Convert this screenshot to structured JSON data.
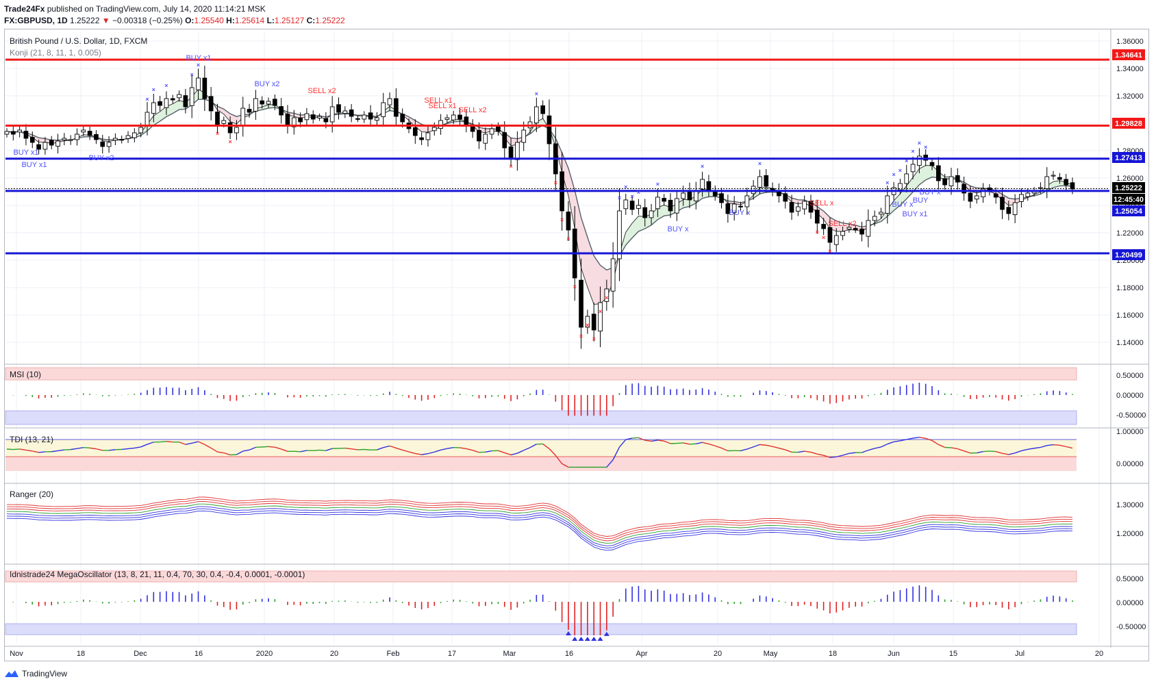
{
  "header": {
    "publisher": "Trade24Fx",
    "published_text": "published on TradingView.com, July 14, 2020 11:14:21 MSK",
    "symbol": "FX:GBPUSD, 1D",
    "last": "1.25222",
    "change": "−0.00318 (−0.25%)",
    "o_label": "O:",
    "o": "1.25540",
    "h_label": "H:",
    "h": "1.25614",
    "l_label": "L:",
    "l": "1.25127",
    "c_label": "C:",
    "c": "1.25222"
  },
  "colors": {
    "up": "#ffffff",
    "down": "#000000",
    "red_line": "#f21818",
    "blue_line": "#1515d6",
    "buy": "#5050ff",
    "sell": "#ff3030",
    "grid": "#eceff4"
  },
  "chart_data": [
    {
      "type": "candlestick",
      "title": "British Pound / U.S. Dollar, 1D, FXCM",
      "indicator": "Konji (21, 8, 11, 1, 0.005)",
      "ylim": [
        1.13,
        1.365
      ],
      "y_ticks": [
        "1.36000",
        "1.34000",
        "1.32000",
        "1.30000",
        "1.28000",
        "1.26000",
        "1.24000",
        "1.22000",
        "1.20000",
        "1.18000",
        "1.16000",
        "1.14000"
      ],
      "x_ticks": [
        "Nov",
        "18",
        "Dec",
        "16",
        "2020",
        "20",
        "Feb",
        "17",
        "Mar",
        "16",
        "Apr",
        "20",
        "May",
        "18",
        "Jun",
        "15",
        "Jul",
        "20"
      ],
      "levels": [
        {
          "label": "1.34641",
          "value": 1.34641,
          "color": "red"
        },
        {
          "label": "1.29828",
          "value": 1.29828,
          "color": "red"
        },
        {
          "label": "1.27413",
          "value": 1.27413,
          "color": "blue"
        },
        {
          "label": "1.25054",
          "value": 1.25054,
          "color": "blue"
        },
        {
          "label": "1.20499",
          "value": 1.20499,
          "color": "blue"
        }
      ],
      "price_label": "1.25222",
      "countdown": "12:45:40",
      "closes": [
        1.294,
        1.292,
        1.295,
        1.289,
        1.286,
        1.281,
        1.286,
        1.284,
        1.287,
        1.289,
        1.288,
        1.292,
        1.295,
        1.291,
        1.288,
        1.283,
        1.286,
        1.289,
        1.288,
        1.291,
        1.293,
        1.297,
        1.308,
        1.315,
        1.313,
        1.318,
        1.317,
        1.321,
        1.312,
        1.326,
        1.333,
        1.318,
        1.309,
        1.299,
        1.302,
        1.293,
        1.297,
        1.311,
        1.308,
        1.318,
        1.314,
        1.316,
        1.313,
        1.306,
        1.299,
        1.304,
        1.301,
        1.307,
        1.303,
        1.305,
        1.301,
        1.312,
        1.308,
        1.309,
        1.305,
        1.303,
        1.306,
        1.303,
        1.304,
        1.315,
        1.318,
        1.305,
        1.301,
        1.296,
        1.291,
        1.288,
        1.293,
        1.297,
        1.302,
        1.304,
        1.306,
        1.303,
        1.299,
        1.294,
        1.287,
        1.292,
        1.296,
        1.294,
        1.282,
        1.275,
        1.286,
        1.295,
        1.301,
        1.312,
        1.307,
        1.285,
        1.263,
        1.236,
        1.222,
        1.187,
        1.151,
        1.159,
        1.149,
        1.169,
        1.179,
        1.201,
        1.236,
        1.244,
        1.237,
        1.24,
        1.231,
        1.236,
        1.246,
        1.243,
        1.236,
        1.245,
        1.249,
        1.244,
        1.251,
        1.259,
        1.251,
        1.247,
        1.242,
        1.234,
        1.241,
        1.239,
        1.247,
        1.254,
        1.261,
        1.254,
        1.251,
        1.247,
        1.243,
        1.235,
        1.239,
        1.243,
        1.235,
        1.227,
        1.223,
        1.213,
        1.218,
        1.221,
        1.224,
        1.222,
        1.219,
        1.229,
        1.232,
        1.235,
        1.247,
        1.253,
        1.256,
        1.263,
        1.27,
        1.276,
        1.273,
        1.269,
        1.258,
        1.255,
        1.261,
        1.257,
        1.249,
        1.243,
        1.247,
        1.252,
        1.25,
        1.246,
        1.237,
        1.234,
        1.242,
        1.248,
        1.249,
        1.251,
        1.253,
        1.261,
        1.262,
        1.259,
        1.255,
        1.252
      ],
      "ma_fast": "dark green/red cloud",
      "labels": [
        "BUY x1",
        "BUY x1",
        "BUY x2",
        "BUY x1",
        "BUY x2",
        "SELL x2",
        "SELL x1",
        "SELL x2",
        "SELL x1",
        "BUY x",
        "BUY x",
        "SELL x2",
        "SELL x",
        "BUY x",
        "BUY x1",
        "BUY",
        "BUY x"
      ]
    },
    {
      "type": "bar",
      "title": "MSI (10)",
      "ylim": [
        -0.7,
        0.7
      ],
      "y_ticks": [
        "0.50000",
        "0.00000",
        "-0.50000"
      ],
      "zones": [
        0.4,
        -0.4
      ]
    },
    {
      "type": "line",
      "title": "TDI (13, 21)",
      "ylim": [
        -0.2,
        1.05
      ],
      "y_ticks": [
        "1.00000",
        "0.00000"
      ]
    },
    {
      "type": "line",
      "title": "Ranger (20)",
      "ylim": [
        1.14,
        1.37
      ],
      "y_ticks": [
        "1.30000",
        "1.20000"
      ]
    },
    {
      "type": "bar",
      "title": "Idnistrade24 MegaOscillator (13, 8, 21, 11, 0.4, 70, 30, 0.4, -0.4, 0.0001, -0.0001)",
      "ylim": [
        -0.75,
        0.75
      ],
      "y_ticks": [
        "0.50000",
        "0.00000",
        "-0.50000"
      ],
      "zones": [
        0.5,
        -0.5
      ]
    }
  ],
  "footer": {
    "brand": "TradingView"
  }
}
